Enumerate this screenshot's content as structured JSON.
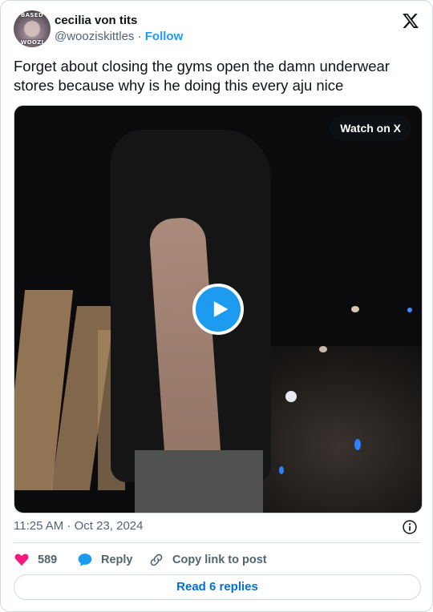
{
  "author": {
    "display_name": "cecilia von tits",
    "handle": "@wooziskittles",
    "separator": "·",
    "follow_label": "Follow",
    "avatar_text_top": "BASED",
    "avatar_text_bottom": "WOOZI"
  },
  "tweet": {
    "text": "Forget about closing the gyms open the damn underwear stores because why is he doing this every aju nice"
  },
  "media": {
    "watch_label": "Watch on X"
  },
  "meta": {
    "timestamp": "11:25 AM · Oct 23, 2024"
  },
  "actions": {
    "like_count": "589",
    "reply_label": "Reply",
    "copy_label": "Copy link to post"
  },
  "footer": {
    "read_replies_label": "Read 6 replies"
  },
  "colors": {
    "accent": "#1d9bf0",
    "like": "#f91880",
    "text_primary": "#0f1419",
    "text_secondary": "#536471",
    "border": "#cfd9de"
  },
  "icons": {
    "brand": "x-logo-icon",
    "play": "play-icon",
    "info": "info-icon",
    "like": "heart-icon",
    "reply": "speech-bubble-icon",
    "copy": "link-icon"
  }
}
